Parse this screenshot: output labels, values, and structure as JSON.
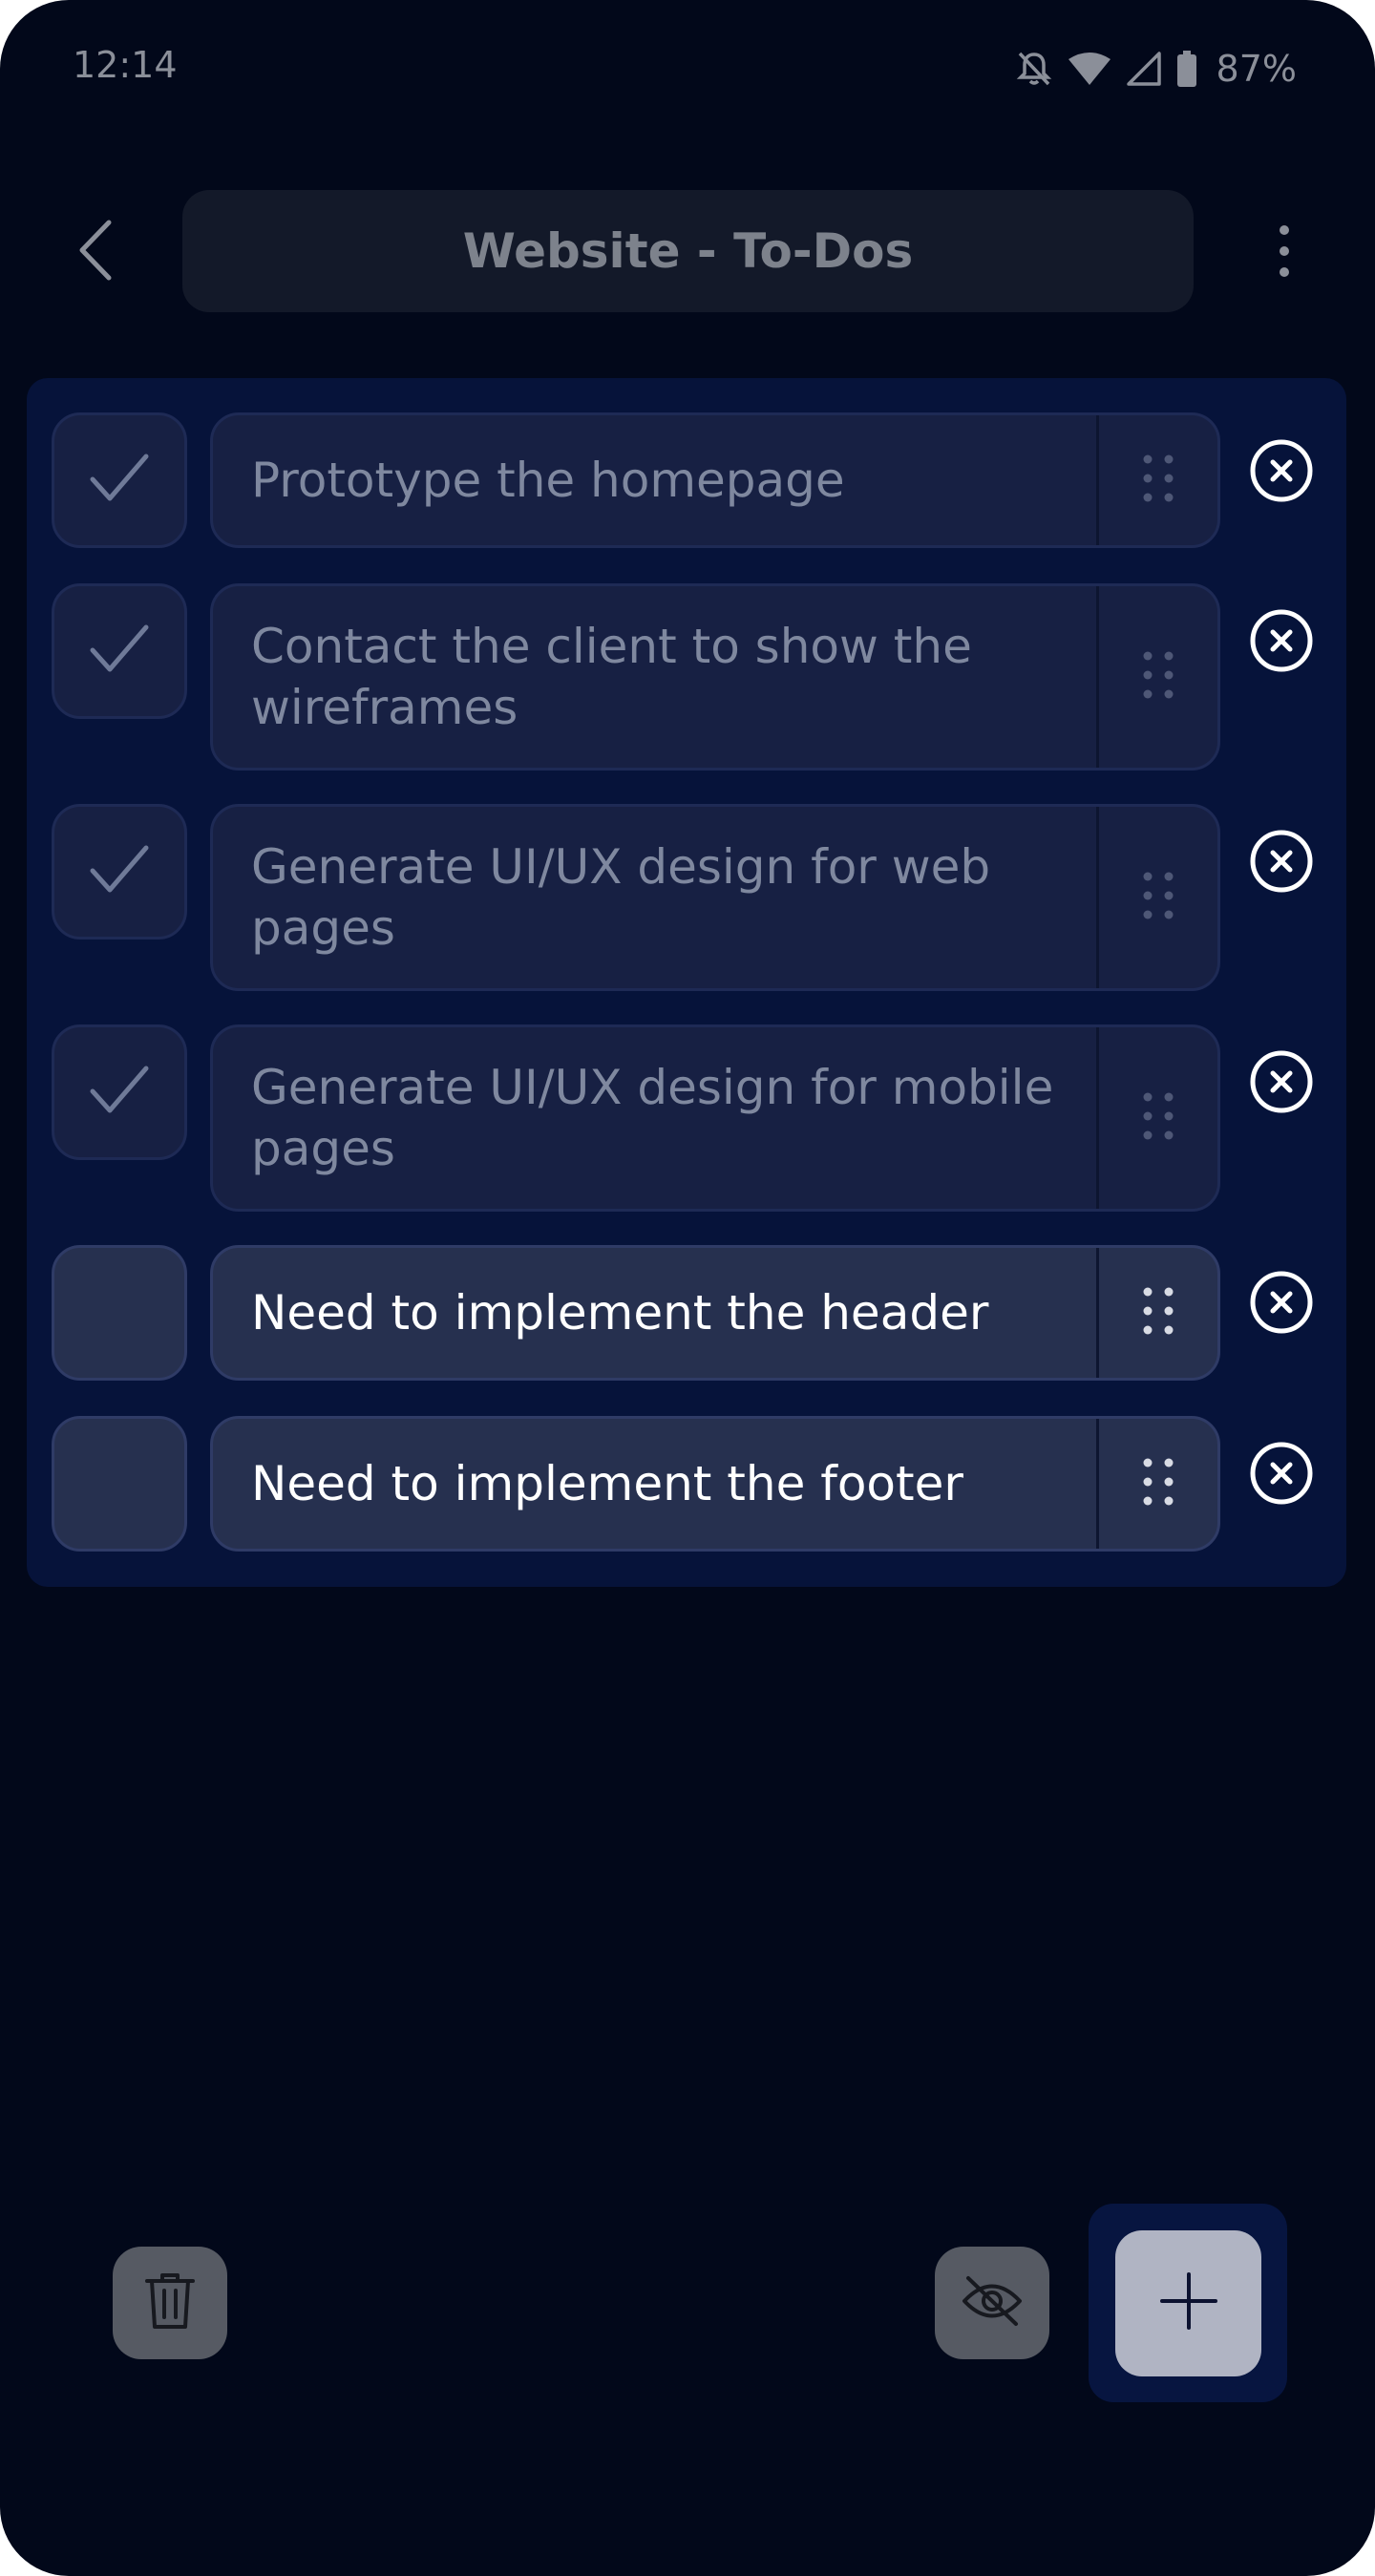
{
  "status_bar": {
    "time": "12:14",
    "battery": "87%",
    "icons": [
      "bell-off-icon",
      "wifi-icon",
      "cell-signal-icon",
      "battery-icon"
    ]
  },
  "header": {
    "title": "Website - To-Dos",
    "back_icon": "chevron-left-icon",
    "menu_icon": "more-vertical-icon"
  },
  "todos": [
    {
      "text": "Prototype the homepage",
      "done": true
    },
    {
      "text": "Contact the client to show the wireframes",
      "done": true
    },
    {
      "text": "Generate UI/UX design for web pages",
      "done": true
    },
    {
      "text": "Generate UI/UX design for mobile pages",
      "done": true
    },
    {
      "text": "Need to implement the header",
      "done": false
    },
    {
      "text": "Need to implement the footer",
      "done": false
    }
  ],
  "bottom_bar": {
    "delete_icon": "trash-icon",
    "hide_completed_icon": "eye-off-icon",
    "add_icon": "plus-icon"
  },
  "colors": {
    "background": "#02081a",
    "panel": "#06133a",
    "item_done": "#172043",
    "item_open": "#26304f",
    "text_done": "#7f889f",
    "text_open": "#ffffff",
    "fab": "#b0b4c3"
  }
}
